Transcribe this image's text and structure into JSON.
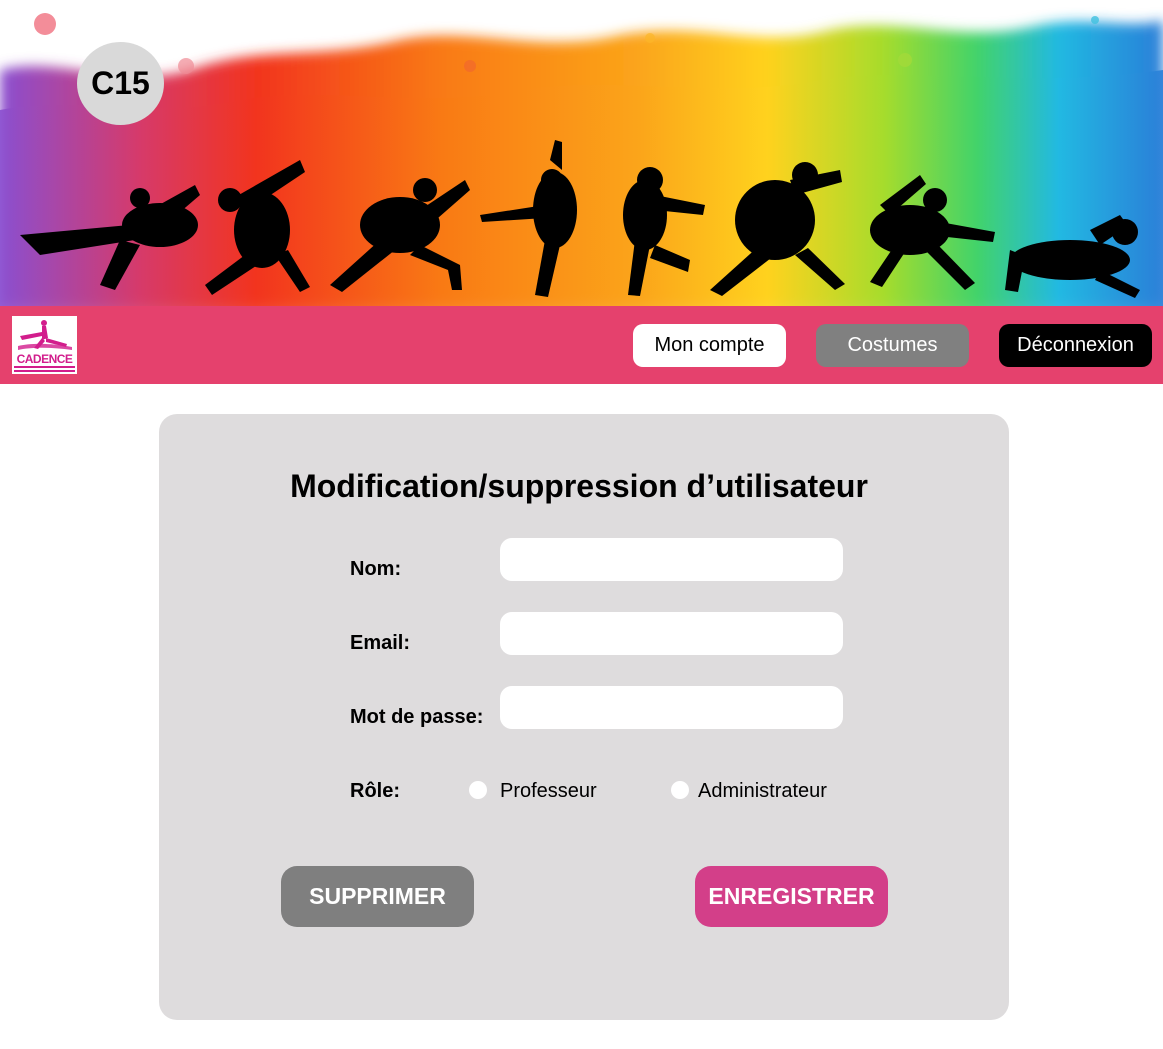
{
  "banner": {
    "page_badge": "C15",
    "image": "dancers-silhouettes-paint-splash"
  },
  "nav": {
    "logo_text": "CADENCE",
    "logo_icon": "dancer-logo-icon",
    "my_account_label": "Mon compte",
    "costumes_label": "Costumes",
    "logout_label": "Déconnexion"
  },
  "form": {
    "title": "Modification/suppression d’utilisateur",
    "name_label": "Nom:",
    "name_value": "",
    "email_label": "Email:",
    "email_value": "",
    "password_label": "Mot de passe:",
    "password_value": "",
    "role_label": "Rôle:",
    "role_options": [
      "Professeur",
      "Administrateur"
    ],
    "delete_label": "SUPPRIMER",
    "save_label": "ENREGISTRER"
  },
  "colors": {
    "navbar": "#e5416d",
    "card": "#dedcdd",
    "delete_button": "#7f7f7f",
    "save_button": "#d33f89",
    "costumes_button": "#808080",
    "logout_button": "#000000"
  }
}
